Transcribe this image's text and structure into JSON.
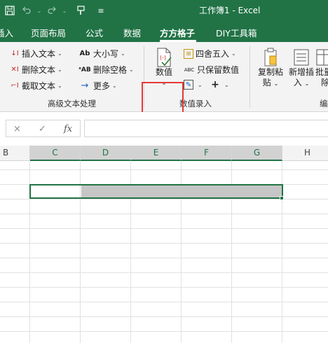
{
  "window": {
    "title": "工作簿1  -  Excel"
  },
  "quick_access": {
    "save_icon": "save-icon",
    "undo_icon": "undo-icon",
    "redo_icon": "redo-icon",
    "customize_icon": "customize-qat-icon"
  },
  "tabs": [
    {
      "label": "插入",
      "active": false
    },
    {
      "label": "页面布局",
      "active": false
    },
    {
      "label": "公式",
      "active": false
    },
    {
      "label": "数据",
      "active": false
    },
    {
      "label": "方方格子",
      "active": true
    },
    {
      "label": "DIY工具箱",
      "active": false
    }
  ],
  "ribbon": {
    "text_group": {
      "label": "高级文本处理",
      "insert_text": "插入文本",
      "delete_text": "删除文本",
      "extract_text": "截取文本",
      "case": "大小写",
      "delete_space": "删除空格",
      "more": "更多"
    },
    "number_group": {
      "label": "数值录入",
      "value_button": "数值",
      "round": "四舍五入",
      "keep_value": "只保留数值"
    },
    "edit_group": {
      "copy_paste": "复制粘",
      "copy_paste_2": "贴",
      "new_insert": "新增插",
      "new_insert_2": "入",
      "batch_delete": "批量",
      "batch_delete_2": "除",
      "trailing_label": "编"
    }
  },
  "formula_bar": {
    "cancel_icon": "×",
    "enter_icon": "✓",
    "fx_label": "fx",
    "value": ""
  },
  "grid": {
    "columns": [
      "B",
      "C",
      "D",
      "E",
      "F",
      "G",
      "H"
    ],
    "selected_columns": [
      "C",
      "D",
      "E",
      "F",
      "G"
    ]
  },
  "colors": {
    "accent": "#217346",
    "highlight": "#e53935"
  }
}
